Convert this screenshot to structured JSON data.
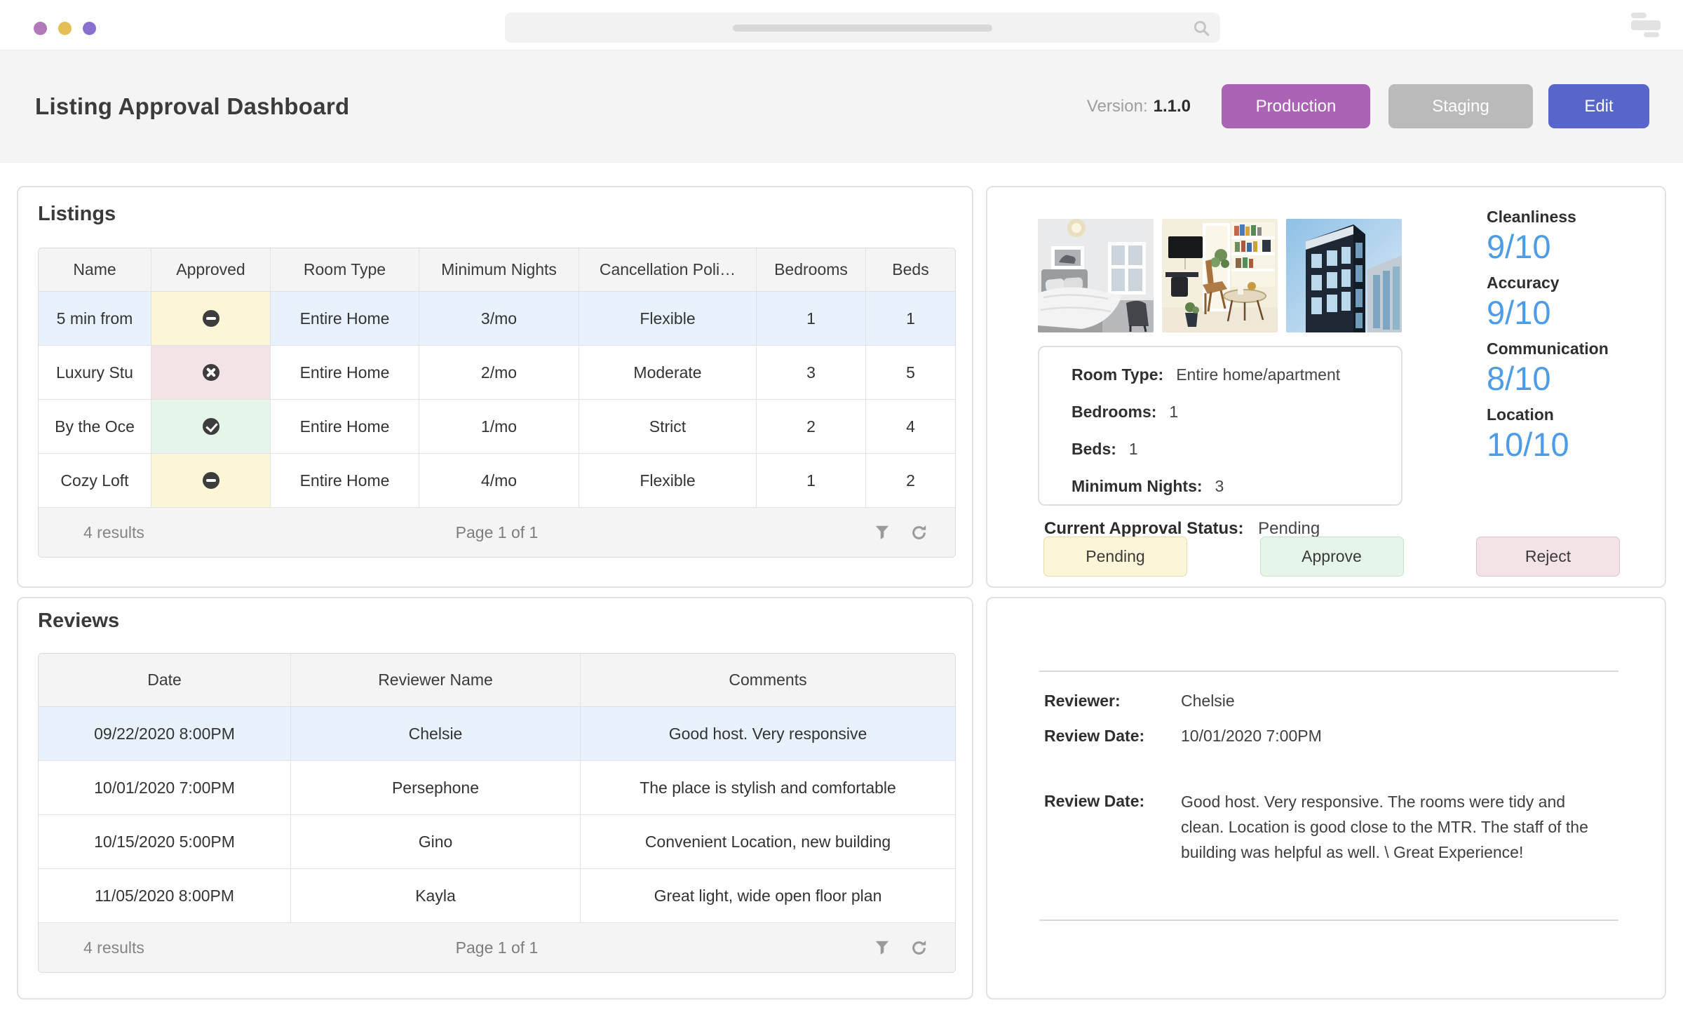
{
  "colors": {
    "dot1": "#b279b8",
    "dot2": "#e5bf55",
    "dot3": "#8a6fd0",
    "production": "#ab64b5",
    "staging": "#bababa",
    "edit": "#5866c9",
    "rating": "#4d9ce8",
    "pending": "#fbf6d8",
    "approved": "#e6f5e9",
    "rejected": "#f3e2e6",
    "badge": "#3d3d3d"
  },
  "header": {
    "title": "Listing Approval Dashboard",
    "version_label": "Version:",
    "version": "1.1.0",
    "buttons": [
      {
        "label": "Production"
      },
      {
        "label": "Staging"
      },
      {
        "label": "Edit"
      }
    ]
  },
  "listings": {
    "title": "Listings",
    "columns": [
      "Name",
      "Approved",
      "Room Type",
      "Minimum Nights",
      "Cancellation Poli…",
      "Bedrooms",
      "Beds"
    ],
    "rows": [
      {
        "name": "5 min from",
        "approved": "pending",
        "room_type": "Entire Home",
        "minimum_nights": "3/mo",
        "cancellation_policy": "Flexible",
        "bedrooms": "1",
        "beds": "1",
        "selected": true
      },
      {
        "name": "Luxury Stu",
        "approved": "rejected",
        "room_type": "Entire Home",
        "minimum_nights": "2/mo",
        "cancellation_policy": "Moderate",
        "bedrooms": "3",
        "beds": "5",
        "selected": false
      },
      {
        "name": "By the Oce",
        "approved": "approved",
        "room_type": "Entire Home",
        "minimum_nights": "1/mo",
        "cancellation_policy": "Strict",
        "bedrooms": "2",
        "beds": "4",
        "selected": false
      },
      {
        "name": "Cozy Loft",
        "approved": "pending",
        "room_type": "Entire Home",
        "minimum_nights": "4/mo",
        "cancellation_policy": "Flexible",
        "bedrooms": "1",
        "beds": "2",
        "selected": false
      }
    ],
    "footer": {
      "results": "4 results",
      "page": "Page 1 of 1"
    }
  },
  "listing_detail": {
    "photos": [
      "bedroom",
      "living-room",
      "building-exterior"
    ],
    "ratings": [
      {
        "label": "Cleanliness",
        "value": "9/10"
      },
      {
        "label": "Accuracy",
        "value": "9/10"
      },
      {
        "label": "Communication",
        "value": "8/10"
      },
      {
        "label": "Location",
        "value": "10/10"
      }
    ],
    "info": [
      {
        "label": "Room Type:",
        "value": "Entire home/apartment"
      },
      {
        "label": "Bedrooms:",
        "value": "1"
      },
      {
        "label": "Beds:",
        "value": "1"
      },
      {
        "label": "Minimum Nights:",
        "value": "3"
      }
    ],
    "status_label": "Current Approval Status:",
    "status_value": "Pending",
    "actions": [
      {
        "label": "Pending"
      },
      {
        "label": "Approve"
      },
      {
        "label": "Reject"
      }
    ]
  },
  "reviews": {
    "title": "Reviews",
    "columns": [
      "Date",
      "Reviewer Name",
      "Comments"
    ],
    "rows": [
      {
        "date": "09/22/2020 8:00PM",
        "reviewer": "Chelsie",
        "comments": "Good host. Very responsive",
        "selected": true
      },
      {
        "date": "10/01/2020 7:00PM",
        "reviewer": "Persephone",
        "comments": "The place is stylish and comfortable",
        "selected": false
      },
      {
        "date": "10/15/2020 5:00PM",
        "reviewer": "Gino",
        "comments": "Convenient Location, new building",
        "selected": false
      },
      {
        "date": "11/05/2020 8:00PM",
        "reviewer": "Kayla",
        "comments": "Great light, wide open floor plan",
        "selected": false
      }
    ],
    "footer": {
      "results": "4 results",
      "page": "Page 1 of 1"
    }
  },
  "review_detail": {
    "fields": [
      {
        "label": "Reviewer:",
        "value": "Chelsie"
      },
      {
        "label": "Review Date:",
        "value": "10/01/2020 7:00PM"
      },
      {
        "label": "Review Date:",
        "value": "Good host. Very responsive. The rooms were tidy and clean. Location is good close to the MTR. The staff of the building was helpful as well. \\ Great Experience!"
      }
    ]
  }
}
